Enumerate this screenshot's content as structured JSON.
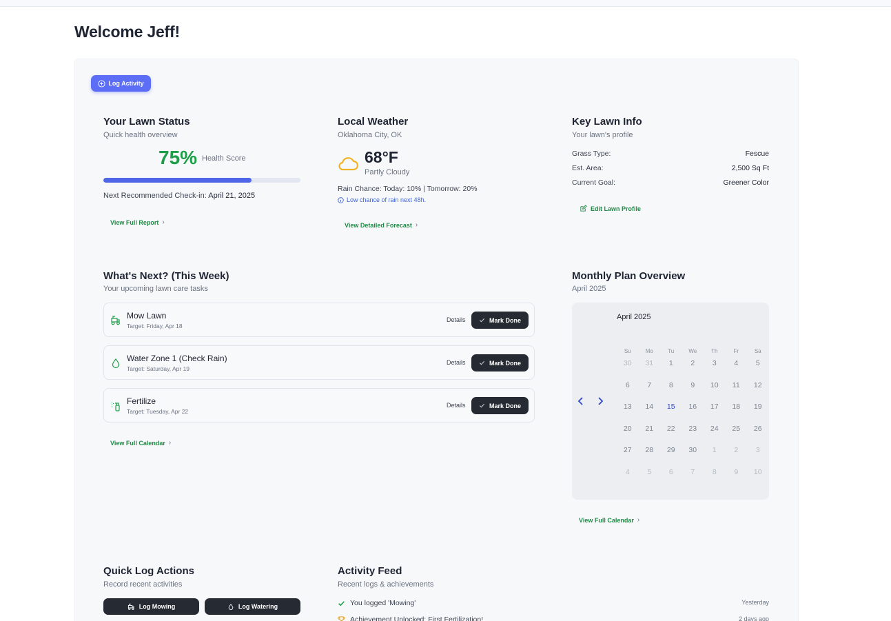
{
  "header": {
    "welcome": "Welcome Jeff!"
  },
  "actions": {
    "log_activity": "Log Activity"
  },
  "lawn_status": {
    "title": "Your Lawn Status",
    "subtitle": "Quick health overview",
    "score": "75%",
    "score_label": "Health Score",
    "progress_fraction": 0.75,
    "checkin_label": "Next Recommended Check-in:",
    "checkin_date": "April 21, 2025",
    "link": "View Full Report"
  },
  "weather": {
    "title": "Local Weather",
    "location": "Oklahoma City, OK",
    "icon": "cloud-icon",
    "temperature": "68°F",
    "condition": "Partly Cloudy",
    "rain": "Rain Chance: Today: 10% | Tomorrow: 20%",
    "note": "Low chance of rain next 48h.",
    "link": "View Detailed Forecast"
  },
  "lawn_info": {
    "title": "Key Lawn Info",
    "subtitle": "Your lawn's profile",
    "rows": [
      {
        "label": "Grass Type:",
        "value": "Fescue"
      },
      {
        "label": "Est. Area:",
        "value": "2,500 Sq Ft"
      },
      {
        "label": "Current Goal:",
        "value": "Greener Color"
      }
    ],
    "edit_link": "Edit Lawn Profile"
  },
  "tasks": {
    "title": "What's Next? (This Week)",
    "subtitle": "Your upcoming lawn care tasks",
    "details_label": "Details",
    "done_label": "Mark Done",
    "items": [
      {
        "name": "Mow Lawn",
        "target": "Target: Friday, Apr 18",
        "icon": "mower-icon"
      },
      {
        "name": "Water Zone 1 (Check Rain)",
        "target": "Target: Saturday, Apr 19",
        "icon": "water-drop-icon"
      },
      {
        "name": "Fertilize",
        "target": "Target: Tuesday, Apr 22",
        "icon": "spray-bottle-icon"
      }
    ],
    "link": "View Full Calendar"
  },
  "monthly_plan": {
    "title": "Monthly Plan Overview",
    "subtitle": "April 2025",
    "calendar_month": "April 2025",
    "weekdays": [
      "Su",
      "Mo",
      "Tu",
      "We",
      "Th",
      "Fr",
      "Sa"
    ],
    "weeks": [
      [
        "30",
        "31",
        "1",
        "2",
        "3",
        "4",
        "5"
      ],
      [
        "6",
        "7",
        "8",
        "9",
        "10",
        "11",
        "12"
      ],
      [
        "13",
        "14",
        "15",
        "16",
        "17",
        "18",
        "19"
      ],
      [
        "20",
        "21",
        "22",
        "23",
        "24",
        "25",
        "26"
      ],
      [
        "27",
        "28",
        "29",
        "30",
        "1",
        "2",
        "3"
      ],
      [
        "4",
        "5",
        "6",
        "7",
        "8",
        "9",
        "10"
      ]
    ],
    "today": "15",
    "link": "View Full Calendar"
  },
  "quick_log": {
    "title": "Quick Log Actions",
    "subtitle": "Record recent activities",
    "mowing": "Log Mowing",
    "watering": "Log Watering"
  },
  "feed": {
    "title": "Activity Feed",
    "subtitle": "Recent logs & achievements",
    "items": [
      {
        "text": "You logged 'Mowing'",
        "time": "Yesterday",
        "icon": "check-icon"
      },
      {
        "text": "Achievement Unlocked: First Fertilization!",
        "time": "2 days ago",
        "icon": "trophy-icon"
      }
    ]
  },
  "colors": {
    "accent": "#5b6ef5",
    "success": "#1e9e48",
    "link": "#1e8a44",
    "dark_button": "#262a33"
  }
}
